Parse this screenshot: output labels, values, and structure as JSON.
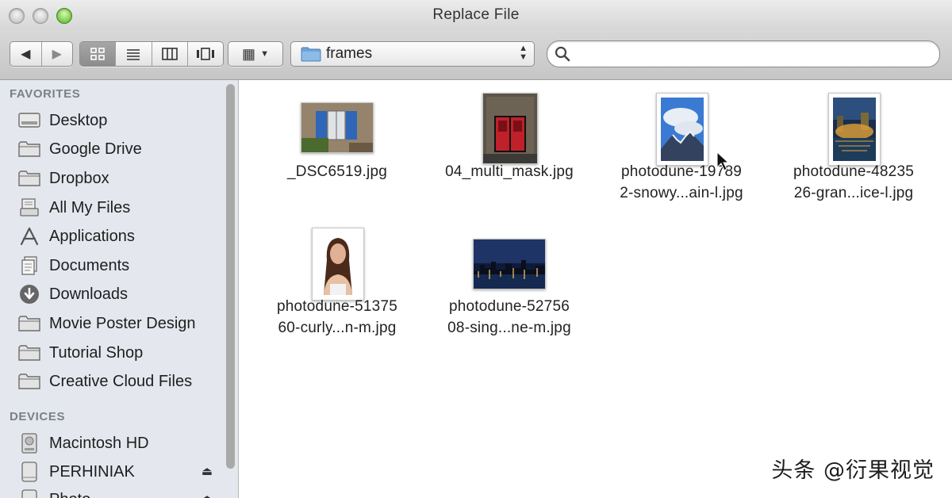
{
  "window": {
    "title": "Replace File"
  },
  "toolbar": {
    "back_icon": "◀",
    "forward_icon": "▶",
    "view_modes": [
      "icon-view",
      "list-view",
      "column-view",
      "cover-flow-view"
    ],
    "arrange_icon": "▦",
    "arrange_caret": "▼",
    "path_label": "frames",
    "search_placeholder": ""
  },
  "sidebar": {
    "favorites_heading": "FAVORITES",
    "favorites": [
      {
        "label": "Desktop",
        "icon": "desktop-icon"
      },
      {
        "label": "Google Drive",
        "icon": "folder-icon"
      },
      {
        "label": "Dropbox",
        "icon": "folder-icon"
      },
      {
        "label": "All My Files",
        "icon": "all-files-icon"
      },
      {
        "label": "Applications",
        "icon": "applications-icon"
      },
      {
        "label": "Documents",
        "icon": "documents-icon"
      },
      {
        "label": "Downloads",
        "icon": "downloads-icon"
      },
      {
        "label": "Movie Poster Design",
        "icon": "folder-icon"
      },
      {
        "label": "Tutorial Shop",
        "icon": "folder-icon"
      },
      {
        "label": "Creative Cloud Files",
        "icon": "folder-icon"
      }
    ],
    "devices_heading": "DEVICES",
    "devices": [
      {
        "label": "Macintosh HD",
        "icon": "hard-drive-icon"
      },
      {
        "label": "PERHINIAK",
        "icon": "external-drive-icon",
        "eject": "⏏"
      },
      {
        "label": "Photo...",
        "icon": "external-drive-icon",
        "eject": "⏏"
      }
    ]
  },
  "files": [
    {
      "line1": "_DSC6519.jpg",
      "line2": "",
      "thumb": "window-shutters"
    },
    {
      "line1": "04_multi_mask.jpg",
      "line2": "",
      "thumb": "red-doors"
    },
    {
      "line1": "photodune-19789",
      "line2": "2-snowy...ain-l.jpg",
      "thumb": "snowy-mountain"
    },
    {
      "line1": "photodune-48235",
      "line2": "26-gran...ice-l.jpg",
      "thumb": "city-night-river"
    },
    {
      "line1": "photodune-51375",
      "line2": "60-curly...n-m.jpg",
      "thumb": "woman-portrait"
    },
    {
      "line1": "photodune-52756",
      "line2": "08-sing...ne-m.jpg",
      "thumb": "skyline-night"
    }
  ],
  "watermark": "头条 @衍果视觉"
}
